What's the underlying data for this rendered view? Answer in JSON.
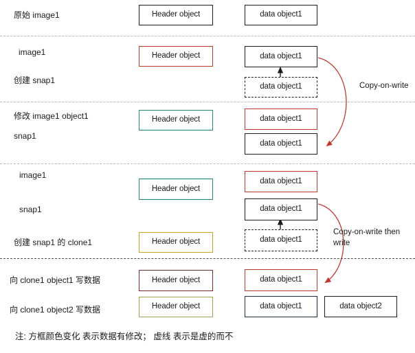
{
  "diagram": {
    "title_note": "注: 方框颜色变化  表示数据有修改； 虚线  表示是虚的而不",
    "colors": {
      "black": "#1a1a1a",
      "red": "#c0392b",
      "teal": "#1f8a70",
      "gold": "#c9a227",
      "olive": "#a3a14a",
      "maroon": "#7a2a2a",
      "navy": "#1c2a4a",
      "arrow": "#c0392b",
      "separator": "#b9b9b9"
    },
    "sections": [
      {
        "id": "original",
        "labels": [
          "原始 image1"
        ],
        "boxes": [
          {
            "text": "Header object",
            "border": "black",
            "style": "solid"
          },
          {
            "text": "data object1",
            "border": "black",
            "style": "solid"
          }
        ]
      },
      {
        "id": "create-snap1",
        "labels": [
          "image1",
          "创建 snap1"
        ],
        "boxes": [
          {
            "text": "Header object",
            "border": "red",
            "style": "solid"
          },
          {
            "text": "data object1",
            "border": "black",
            "style": "solid"
          },
          {
            "text": "data object1",
            "border": "black",
            "style": "dashed"
          }
        ],
        "annotation": "Copy-on-write"
      },
      {
        "id": "modify-image1-object1",
        "labels": [
          "修改 image1 object1",
          "snap1"
        ],
        "boxes": [
          {
            "text": "Header object",
            "border": "teal",
            "style": "solid"
          },
          {
            "text": "data object1",
            "border": "red",
            "style": "solid"
          },
          {
            "text": "data object1",
            "border": "black",
            "style": "solid"
          }
        ]
      },
      {
        "id": "create-clone1",
        "labels": [
          "image1",
          "snap1",
          "创建 snap1 的 clone1"
        ],
        "boxes": [
          {
            "text": "Header object",
            "border": "teal",
            "style": "solid"
          },
          {
            "text": "Header object",
            "border": "gold",
            "style": "solid"
          },
          {
            "text": "data object1",
            "border": "red",
            "style": "solid"
          },
          {
            "text": "data object1",
            "border": "black",
            "style": "solid"
          },
          {
            "text": "data object1",
            "border": "black",
            "style": "dashed"
          }
        ],
        "annotation": "Copy-on-write  then write"
      },
      {
        "id": "write-clone1",
        "labels": [
          "向 clone1 object1 写数据",
          "向 clone1 object2 写数据"
        ],
        "boxes": [
          {
            "text": "Header object",
            "border": "maroon",
            "style": "solid"
          },
          {
            "text": "data object1",
            "border": "red",
            "style": "solid"
          },
          {
            "text": "Header object",
            "border": "olive",
            "style": "solid"
          },
          {
            "text": "data object1",
            "border": "navy",
            "style": "solid"
          },
          {
            "text": "data object2",
            "border": "black",
            "style": "solid"
          }
        ]
      }
    ],
    "annotations": {
      "cow1": "Copy-on-write",
      "cow2_line1": "Copy-on-write  then",
      "cow2_line2": "write"
    }
  }
}
